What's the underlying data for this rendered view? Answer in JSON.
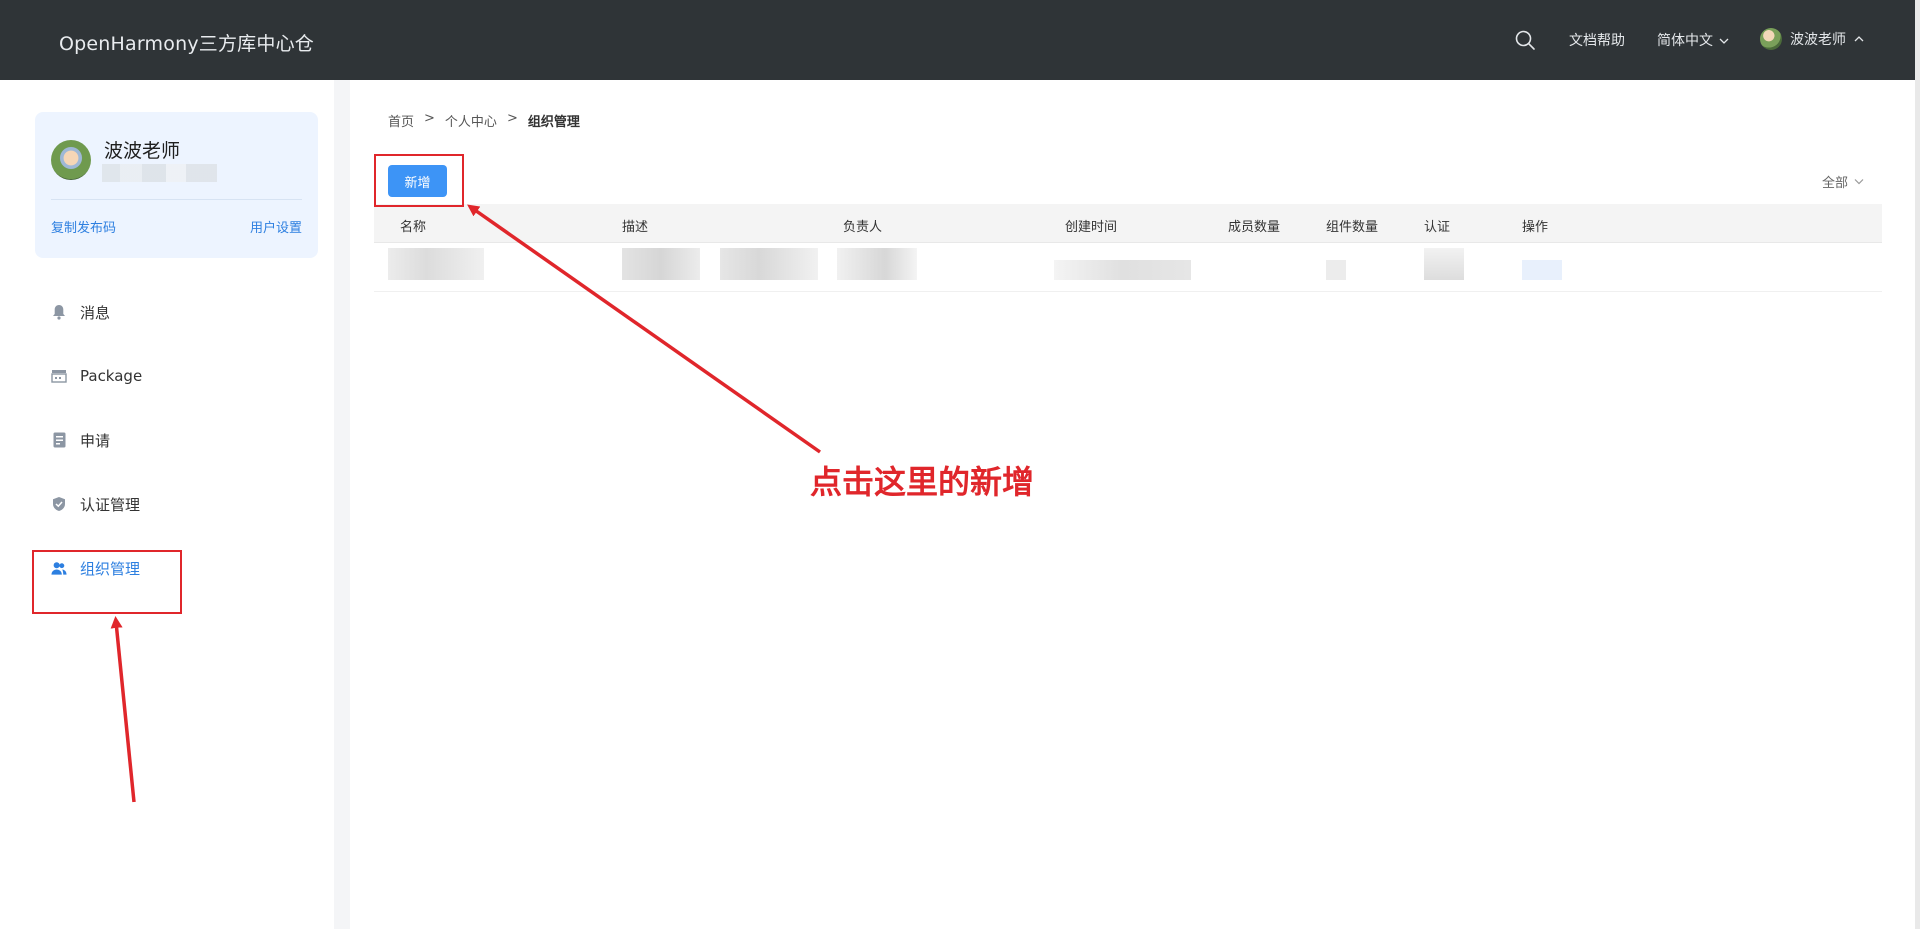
{
  "header": {
    "brand": "OpenHarmony三方库中心仓",
    "docs_label": "文档帮助",
    "language_label": "简体中文",
    "username": "波波老师"
  },
  "profile": {
    "name": "波波老师",
    "copy_code_label": "复制发布码",
    "user_settings_label": "用户设置"
  },
  "sidebar": {
    "items": [
      {
        "label": "消息",
        "icon": "bell-icon"
      },
      {
        "label": "Package",
        "icon": "package-icon"
      },
      {
        "label": "申请",
        "icon": "document-icon"
      },
      {
        "label": "认证管理",
        "icon": "shield-icon"
      },
      {
        "label": "组织管理",
        "icon": "people-icon",
        "active": true
      }
    ]
  },
  "breadcrumb": {
    "home": "首页",
    "separator": ">",
    "personal_center": "个人中心",
    "current": "组织管理"
  },
  "toolbar": {
    "add_label": "新增",
    "filter_label": "全部"
  },
  "table": {
    "columns": [
      "名称",
      "描述",
      "负责人",
      "创建时间",
      "成员数量",
      "组件数量",
      "认证",
      "操作"
    ]
  },
  "annotation": {
    "text": "点击这里的新增",
    "color": "#e0262b"
  },
  "colors": {
    "topbar": "#2f3437",
    "accent": "#3d94f6",
    "link": "#2d7fe0"
  }
}
